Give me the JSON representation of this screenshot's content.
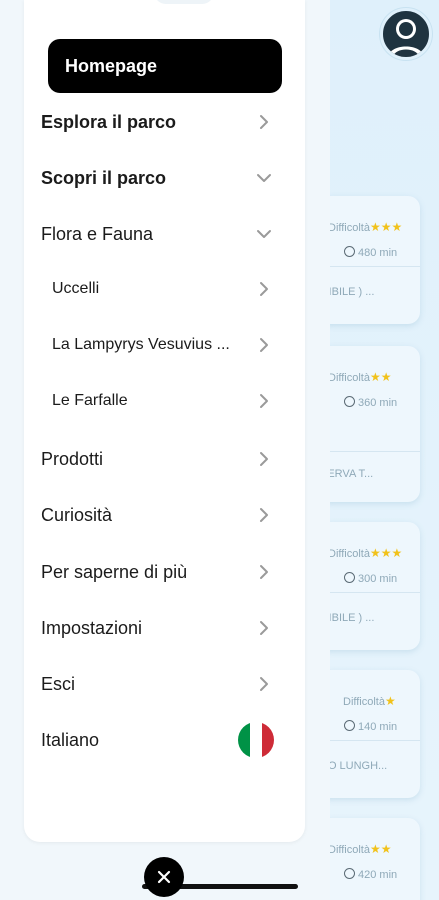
{
  "menu": {
    "items": [
      {
        "label": "Homepage"
      },
      {
        "label": "Esplora il parco"
      },
      {
        "label": "Scopri il parco"
      },
      {
        "label": "Flora e Fauna"
      },
      {
        "label": "Uccelli"
      },
      {
        "label": "La Lampyrys Vesuvius ..."
      },
      {
        "label": "Le Farfalle"
      },
      {
        "label": "Prodotti"
      },
      {
        "label": "Curiosità"
      },
      {
        "label": "Per saperne di più"
      },
      {
        "label": "Impostazioni"
      },
      {
        "label": "Esci"
      },
      {
        "label": "Italiano"
      }
    ]
  },
  "background": {
    "cards": [
      {
        "difficulty": "Difficoltà",
        "stars": "★★★",
        "time": "480 min",
        "desc": "GIBILE ) ..."
      },
      {
        "difficulty": "Difficoltà",
        "stars": "★★",
        "time": "360 min",
        "desc": "SERVA T..."
      },
      {
        "difficulty": "Difficoltà",
        "stars": "★★★",
        "time": "300 min",
        "desc": "GIBILE ) ..."
      },
      {
        "difficulty": "Difficoltà",
        "stars": "★",
        "time": "140 min",
        "desc": "NO LUNGH..."
      },
      {
        "difficulty": "Difficoltà",
        "stars": "★★",
        "time": "420 min",
        "desc": ""
      }
    ]
  },
  "colors": {
    "active_bg": "#000000",
    "star": "#f1c21b",
    "flag_green": "#009246",
    "flag_white": "#ffffff",
    "flag_red": "#ce2b37"
  }
}
